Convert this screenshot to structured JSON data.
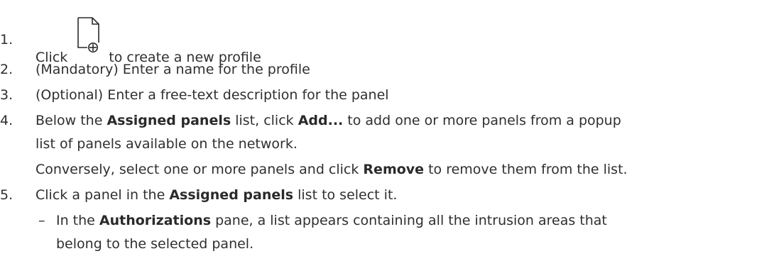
{
  "steps": [
    {
      "num": "1.",
      "before": "Click",
      "after": "to create a new profile",
      "icon": "new-profile-icon"
    },
    {
      "num": "2.",
      "text": "(Mandatory) Enter a name for the profile"
    },
    {
      "num": "3.",
      "text": "(Optional) Enter a free-text description for the panel"
    },
    {
      "num": "4.",
      "line1_a": "Below the ",
      "line1_b": "Assigned panels",
      "line1_c": " list, click ",
      "line1_d": "Add...",
      "line1_e": " to add one or more panels from a popup",
      "line2": "list of panels available on the network.",
      "line3_a": "Conversely, select one or more panels and click ",
      "line3_b": "Remove",
      "line3_c": " to remove them from the list."
    },
    {
      "num": "5.",
      "line1_a": "Click a panel in the ",
      "line1_b": "Assigned panels",
      "line1_c": " list to select it.",
      "sub_dash": "–",
      "sub1_a": "In the ",
      "sub1_b": "Authorizations",
      "sub1_c": " pane, a list appears containing all the intrusion areas that",
      "sub2": "belong to the selected panel."
    }
  ]
}
